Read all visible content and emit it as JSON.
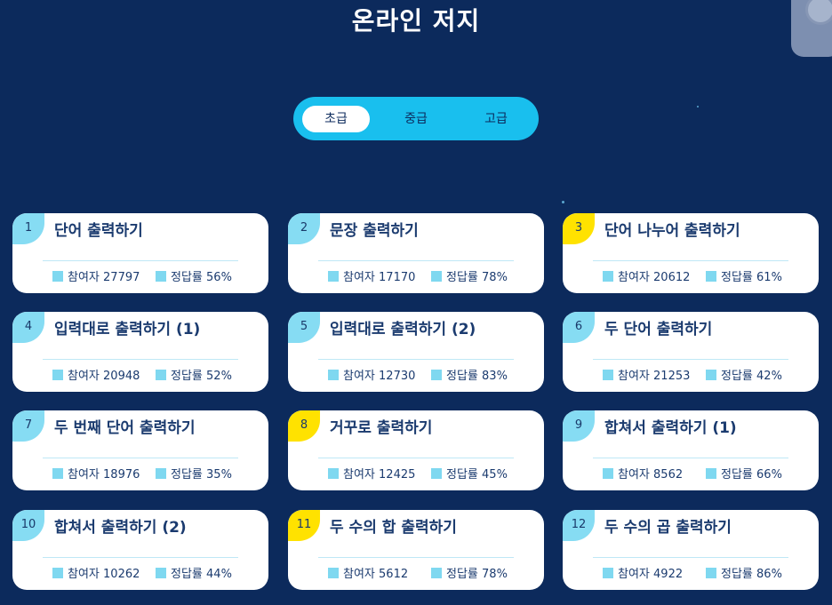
{
  "title": "온라인 저지",
  "tabs": [
    {
      "label": "초급",
      "active": true
    },
    {
      "label": "중급",
      "active": false
    },
    {
      "label": "고급",
      "active": false
    }
  ],
  "stat_labels": {
    "participants": "참여자",
    "accuracy": "정답률"
  },
  "problems": [
    {
      "num": "1",
      "title": "단어 출력하기",
      "participants": "27797",
      "accuracy": "56%",
      "highlight": false
    },
    {
      "num": "2",
      "title": "문장 출력하기",
      "participants": "17170",
      "accuracy": "78%",
      "highlight": false
    },
    {
      "num": "3",
      "title": "단어 나누어 출력하기",
      "participants": "20612",
      "accuracy": "61%",
      "highlight": true
    },
    {
      "num": "4",
      "title": "입력대로 출력하기 (1)",
      "participants": "20948",
      "accuracy": "52%",
      "highlight": false
    },
    {
      "num": "5",
      "title": "입력대로 출력하기 (2)",
      "participants": "12730",
      "accuracy": "83%",
      "highlight": false
    },
    {
      "num": "6",
      "title": "두 단어 출력하기",
      "participants": "21253",
      "accuracy": "42%",
      "highlight": false
    },
    {
      "num": "7",
      "title": "두 번째 단어 출력하기",
      "participants": "18976",
      "accuracy": "35%",
      "highlight": false
    },
    {
      "num": "8",
      "title": "거꾸로 출력하기",
      "participants": "12425",
      "accuracy": "45%",
      "highlight": true
    },
    {
      "num": "9",
      "title": "합쳐서 출력하기 (1)",
      "participants": "8562",
      "accuracy": "66%",
      "highlight": false
    },
    {
      "num": "10",
      "title": "합쳐서 출력하기 (2)",
      "participants": "10262",
      "accuracy": "44%",
      "highlight": false
    },
    {
      "num": "11",
      "title": "두 수의 합 출력하기",
      "participants": "5612",
      "accuracy": "78%",
      "highlight": true
    },
    {
      "num": "12",
      "title": "두 수의 곱 출력하기",
      "participants": "4922",
      "accuracy": "86%",
      "highlight": false
    }
  ]
}
